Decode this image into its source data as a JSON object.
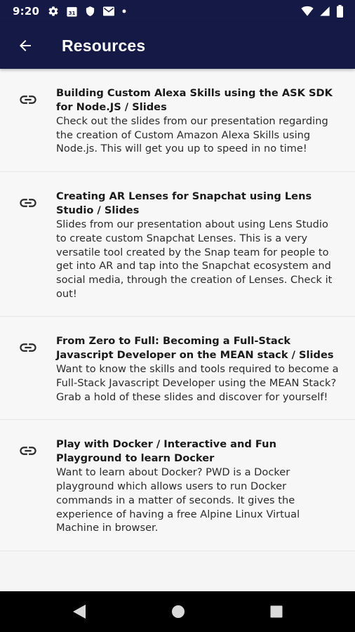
{
  "status_bar": {
    "time": "9:20",
    "left_icons": [
      "gear-icon",
      "calendar-icon",
      "shield-icon",
      "mail-icon",
      "dot-icon"
    ],
    "calendar_day": "31",
    "right_icons": [
      "wifi-icon",
      "signal-icon",
      "battery-icon"
    ]
  },
  "app_bar": {
    "title": "Resources",
    "back_icon": "arrow-back-icon",
    "background": "#141a45"
  },
  "items": [
    {
      "icon": "link-icon",
      "title": "Building Custom Alexa Skills using the ASK SDK for Node.JS / Slides",
      "description": "Check out the slides from our presentation regarding the creation of Custom Amazon Alexa Skills using Node.js. This will get you up to speed in no time!"
    },
    {
      "icon": "link-icon",
      "title": "Creating AR Lenses for Snapchat using Lens Studio / Slides",
      "description": "Slides from our presentation about using Lens Studio to create custom Snapchat Lenses. This is a very versatile tool created by the Snap team for people to get into AR and tap into the Snapchat ecosystem and social media, through the creation of Lenses. Check it out!"
    },
    {
      "icon": "link-icon",
      "title": "From Zero to Full: Becoming a Full-Stack Javascript Developer on the MEAN stack / Slides",
      "description": "Want to know the skills and tools required to become a Full-Stack Javascript Developer using the MEAN Stack? Grab a hold of these slides and discover for yourself!"
    },
    {
      "icon": "link-icon",
      "title": "Play with Docker / Interactive and Fun Playground to learn Docker",
      "description": "Want to learn about Docker? PWD is a Docker playground which allows users to run Docker commands in a matter of seconds. It gives the experience of having a free Alpine Linux Virtual Machine in browser."
    }
  ],
  "nav_bar": {
    "buttons": [
      "back-triangle-icon",
      "home-circle-icon",
      "recents-square-icon"
    ]
  }
}
